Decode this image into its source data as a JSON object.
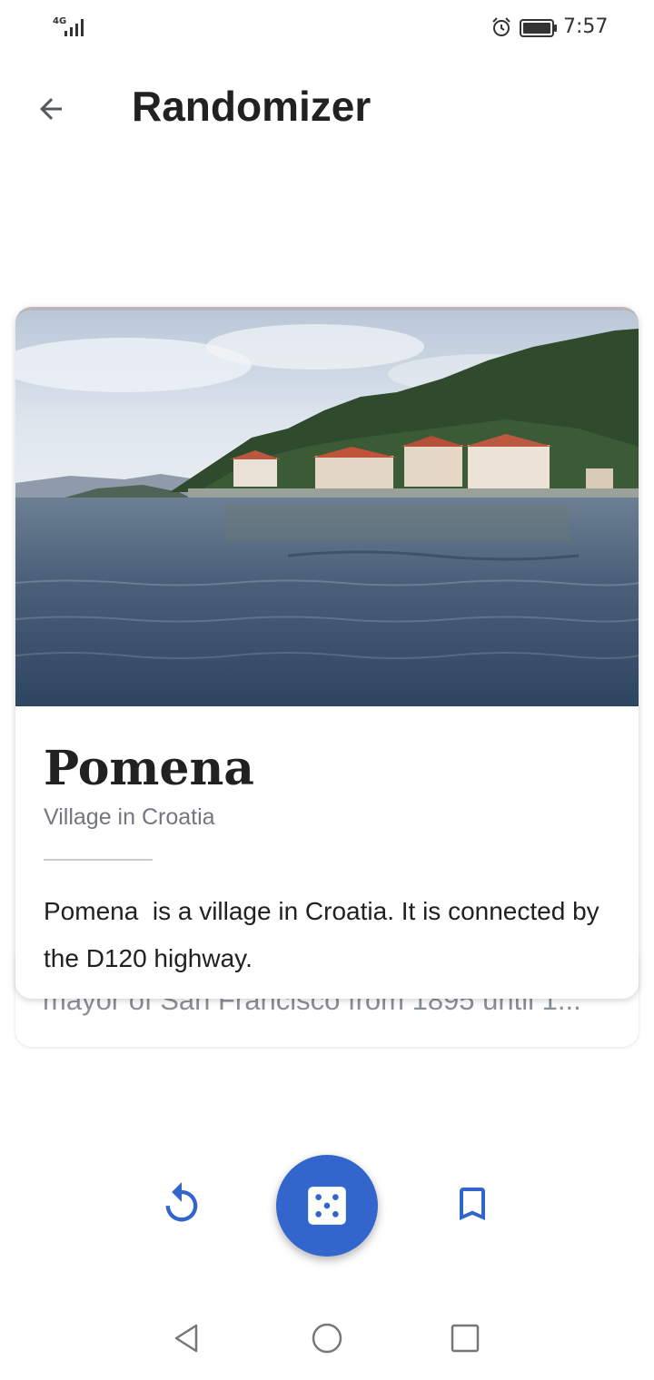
{
  "status_bar": {
    "network": "4G",
    "time": "7:57",
    "icons": [
      "signal-icon",
      "alarm-icon",
      "battery-icon"
    ]
  },
  "app_bar": {
    "title": "Randomizer",
    "back_icon": "arrow-left-icon"
  },
  "card": {
    "title": "Pomena",
    "subtitle": "Village in Croatia",
    "extract": "Pomena  is a village in Croatia. It is connected by the D120 highway.",
    "image_description_icon": "photo"
  },
  "card_behind": {
    "extract_visible": "mayor of San Francisco from 1895 until 1..."
  },
  "actions": {
    "undo_icon": "undo-icon",
    "dice_icon": "dice-icon",
    "save_icon": "bookmark-icon"
  },
  "colors": {
    "accent": "#3366cc",
    "title_text": "#202122",
    "secondary_text": "#72777d",
    "icon_gray": "#6f6f6f"
  },
  "nav_bar": {
    "icons": [
      "nav-back-icon",
      "nav-home-icon",
      "nav-recents-icon"
    ]
  }
}
